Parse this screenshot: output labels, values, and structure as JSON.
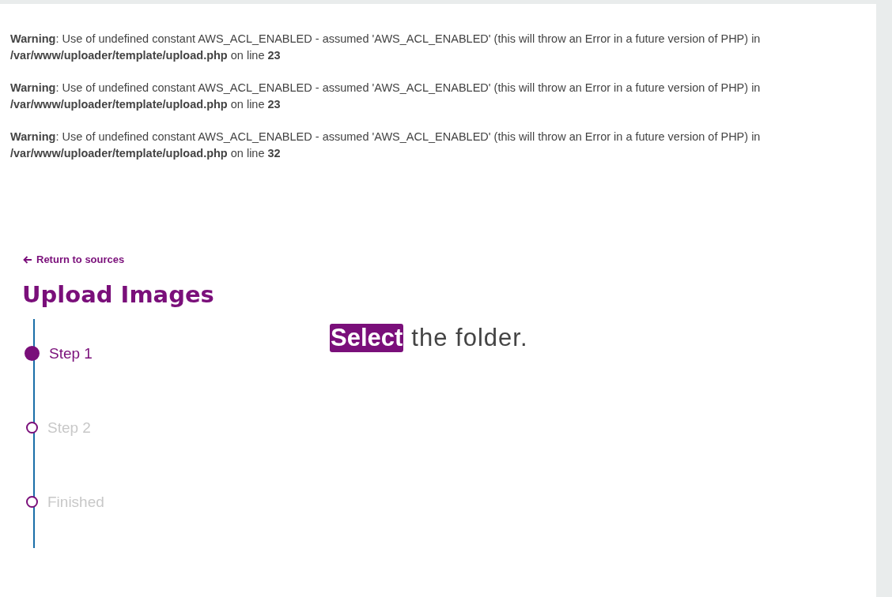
{
  "warnings": [
    "**Warning**: Use of undefined constant AWS_ACL_ENABLED - assumed 'AWS_ACL_ENABLED' (this will throw an Error in a future version of PHP) in **/var/www/uploader/template/upload.php** on line **23**",
    "**Warning**: Use of undefined constant AWS_ACL_ENABLED - assumed 'AWS_ACL_ENABLED' (this will throw an Error in a future version of PHP) in **/var/www/uploader/template/upload.php** on line **23**",
    "**Warning**: Use of undefined constant AWS_ACL_ENABLED - assumed 'AWS_ACL_ENABLED' (this will throw an Error in a future version of PHP) in **/var/www/uploader/template/upload.php** on line **32**"
  ],
  "back_link": "Return to sources",
  "title": "Upload Images",
  "steps": [
    {
      "label": "Step 1",
      "selected": true
    },
    {
      "label": "Step 2",
      "selected": false
    },
    {
      "label": "Finished",
      "selected": false
    }
  ],
  "instruction": {
    "highlight": "Select",
    "rest": "the folder."
  }
}
